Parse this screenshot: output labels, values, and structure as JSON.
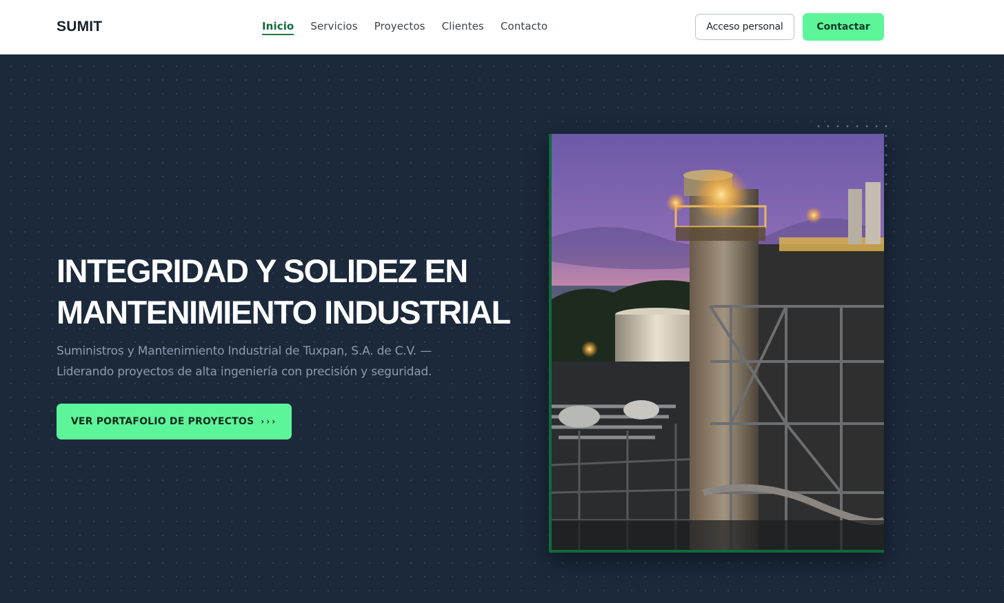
{
  "header": {
    "logo": "SUMIT",
    "nav": [
      "Inicio",
      "Servicios",
      "Proyectos",
      "Clientes",
      "Contacto"
    ],
    "active_nav": "Inicio",
    "login_label": "Acceso personal",
    "contact_label": "Contactar"
  },
  "hero": {
    "title_line1": "INTEGRIDAD Y SOLIDEZ EN",
    "title_line2": "MANTENIMIENTO INDUSTRIAL",
    "subtitle_line1": "Suministros y Mantenimiento Industrial de Tuxpan, S.A. de C.V. —",
    "subtitle_line2": "Liderando proyectos de alta ingeniería con precisión y seguridad.",
    "cta_label": "VER PORTAFOLIO DE PROYECTOS",
    "cta_arrows": "›››"
  },
  "colors": {
    "accent": "#5df59a",
    "accent_dark": "#0f6b3a",
    "hero_bg": "#1b293b",
    "header_bg": "#ffffff"
  }
}
